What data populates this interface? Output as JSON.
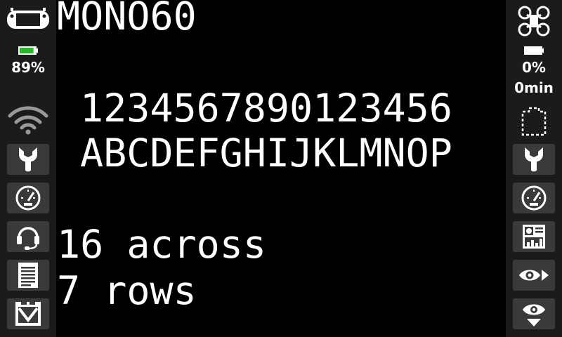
{
  "left_panel": {
    "battery_percent": "89%",
    "battery_level": 0.89,
    "battery_color": "#22bb22"
  },
  "right_panel": {
    "battery_percent": "0%",
    "battery_time": "0min",
    "battery_level": 0
  },
  "screen": {
    "title": "MONO60",
    "line1": "1234567890123456",
    "line2": "ABCDEFGHIJKLMNOP",
    "info1": "16 across",
    "info2": "7 rows"
  },
  "icons": {
    "left": [
      "radio-icon",
      "wifi-icon",
      "wrench-icon",
      "gauge-icon",
      "headset-icon",
      "document-icon",
      "mailbox-icon"
    ],
    "right": [
      "drone-icon",
      "dashed-outline-icon",
      "wrench-icon",
      "gauge-icon",
      "telemetry-screen-icon",
      "eye-arrow-icon",
      "eye-down-icon"
    ]
  }
}
